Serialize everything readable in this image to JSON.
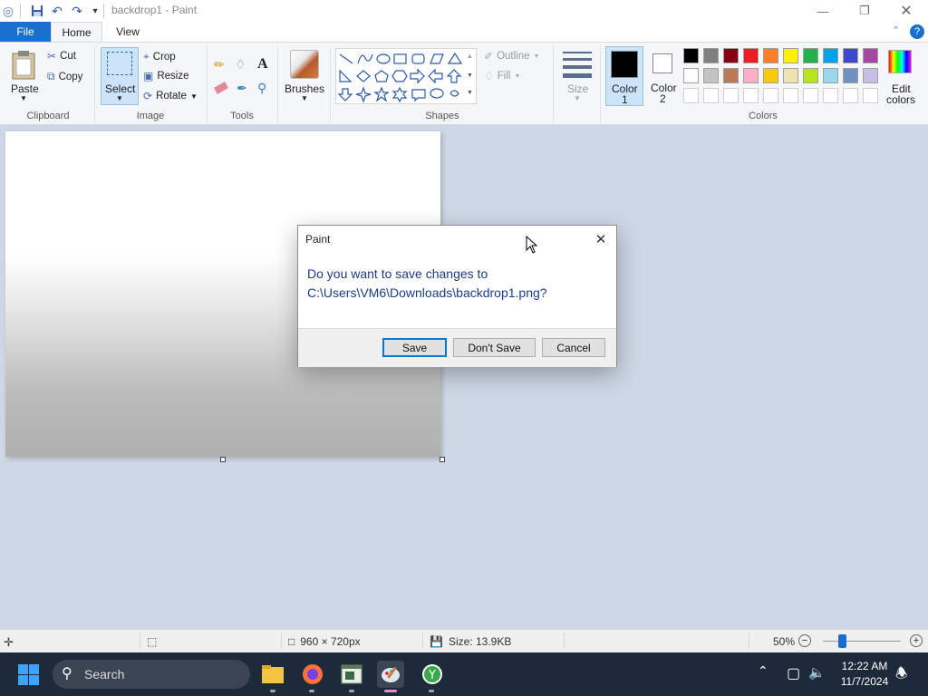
{
  "window": {
    "title": "backdrop1 - Paint"
  },
  "tabs": {
    "file": "File",
    "home": "Home",
    "view": "View"
  },
  "ribbon": {
    "clipboard": {
      "paste": "Paste",
      "cut": "Cut",
      "copy": "Copy",
      "label": "Clipboard"
    },
    "image": {
      "select": "Select",
      "crop": "Crop",
      "resize": "Resize",
      "rotate": "Rotate",
      "label": "Image"
    },
    "tools": {
      "label": "Tools",
      "text_tool": "A"
    },
    "brushes": {
      "label": "Brushes"
    },
    "shapes": {
      "outline": "Outline",
      "fill": "Fill",
      "label": "Shapes"
    },
    "size": {
      "label": "Size"
    },
    "color1": {
      "label_line1": "Color",
      "label_line2": "1",
      "value": "#000000"
    },
    "color2": {
      "label_line1": "Color",
      "label_line2": "2",
      "value": "#ffffff"
    },
    "colors": {
      "label": "Colors",
      "edit_line1": "Edit",
      "edit_line2": "colors",
      "row1": [
        "#000000",
        "#7f7f7f",
        "#880015",
        "#ed1c24",
        "#ff7f27",
        "#fff200",
        "#22b14c",
        "#00a2e8",
        "#3f48cc",
        "#a349a4"
      ],
      "row2": [
        "#ffffff",
        "#c3c3c3",
        "#b97a57",
        "#ffaec9",
        "#ffc90e",
        "#efe4b0",
        "#b5e61d",
        "#99d9ea",
        "#7092be",
        "#c8bfe7"
      ]
    }
  },
  "dialog": {
    "title": "Paint",
    "message_line1": "Do you want to save changes to",
    "message_line2": "C:\\Users\\VM6\\Downloads\\backdrop1.png?",
    "save": "Save",
    "dont_save": "Don't Save",
    "cancel": "Cancel"
  },
  "status": {
    "dimensions": "960 × 720px",
    "size": "Size: 13.9KB",
    "zoom": "50%",
    "zoom_fraction": 0.5
  },
  "taskbar": {
    "search_placeholder": "Search",
    "time": "12:22 AM",
    "date": "11/7/2024"
  }
}
